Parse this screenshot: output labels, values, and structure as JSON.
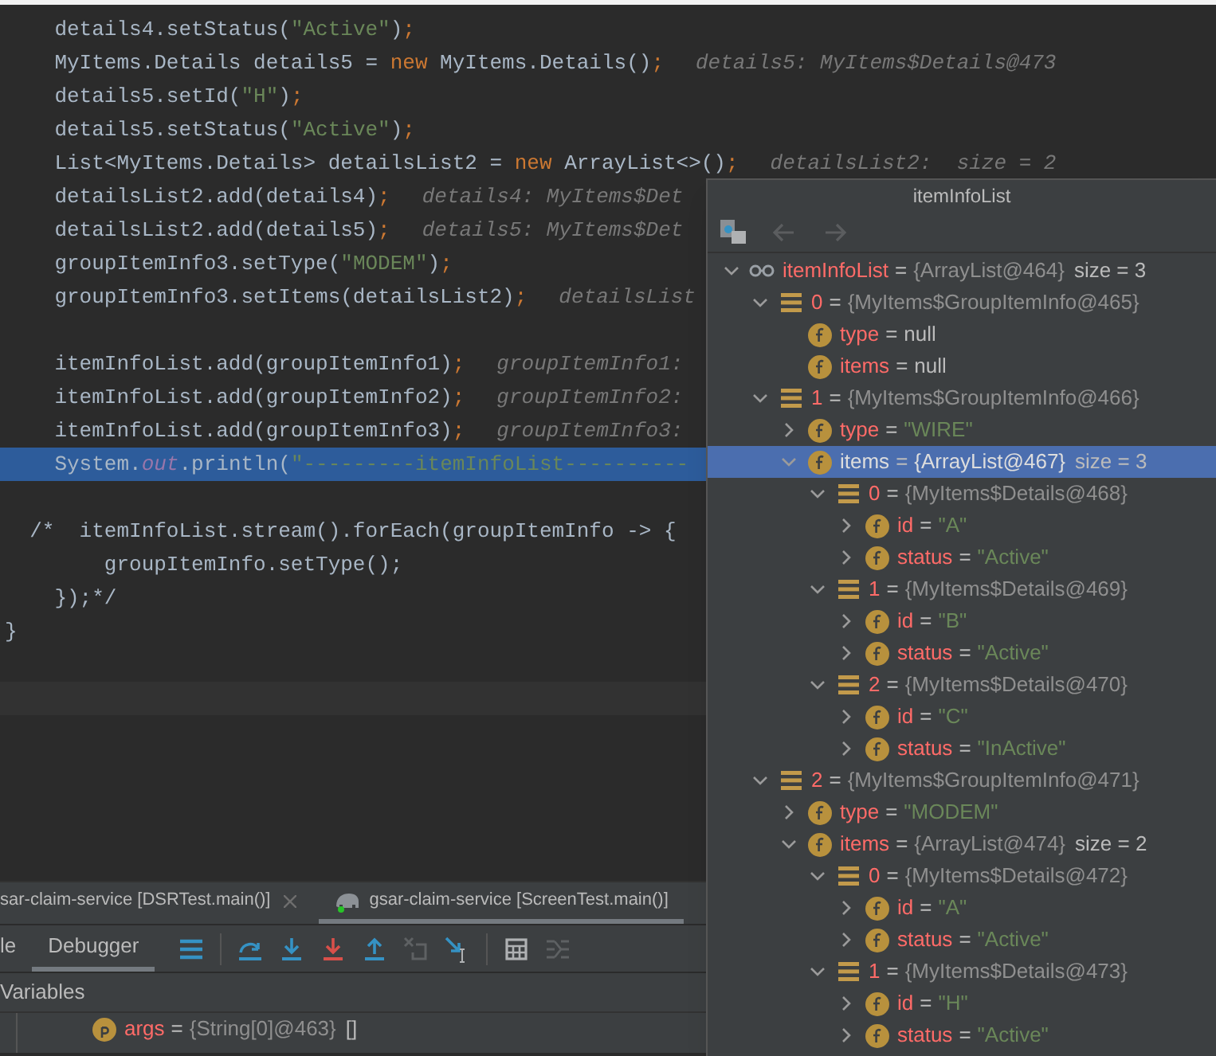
{
  "editor": {
    "lines": [
      {
        "kind": "code",
        "segments": [
          {
            "kind": "plain",
            "text": "    details4.setStatus("
          },
          {
            "kind": "string",
            "text": "\"Active\""
          },
          {
            "kind": "plain",
            "text": ")"
          },
          {
            "kind": "punct",
            "text": ";"
          }
        ]
      },
      {
        "kind": "code",
        "segments": [
          {
            "kind": "plain",
            "text": "    MyItems.Details details5 = "
          },
          {
            "kind": "keyword",
            "text": "new"
          },
          {
            "kind": "plain",
            "text": " MyItems.Details()"
          },
          {
            "kind": "punct",
            "text": ";"
          },
          {
            "kind": "hint",
            "text": "details5: MyItems$Details@473"
          }
        ]
      },
      {
        "kind": "code",
        "segments": [
          {
            "kind": "plain",
            "text": "    details5.setId("
          },
          {
            "kind": "string",
            "text": "\"H\""
          },
          {
            "kind": "plain",
            "text": ")"
          },
          {
            "kind": "punct",
            "text": ";"
          }
        ]
      },
      {
        "kind": "code",
        "segments": [
          {
            "kind": "plain",
            "text": "    details5.setStatus("
          },
          {
            "kind": "string",
            "text": "\"Active\""
          },
          {
            "kind": "plain",
            "text": ")"
          },
          {
            "kind": "punct",
            "text": ";"
          }
        ]
      },
      {
        "kind": "code",
        "segments": [
          {
            "kind": "plain",
            "text": "    List<MyItems.Details> detailsList2 = "
          },
          {
            "kind": "keyword",
            "text": "new"
          },
          {
            "kind": "plain",
            "text": " ArrayList<>()"
          },
          {
            "kind": "punct",
            "text": ";"
          },
          {
            "kind": "hint",
            "text": "detailsList2:  size = 2"
          }
        ]
      },
      {
        "kind": "code",
        "segments": [
          {
            "kind": "plain",
            "text": "    detailsList2.add(details4)"
          },
          {
            "kind": "punct",
            "text": ";"
          },
          {
            "kind": "hint",
            "text": "details4: MyItems$Det"
          }
        ]
      },
      {
        "kind": "code",
        "segments": [
          {
            "kind": "plain",
            "text": "    detailsList2.add(details5)"
          },
          {
            "kind": "punct",
            "text": ";"
          },
          {
            "kind": "hint",
            "text": "details5: MyItems$Det"
          }
        ]
      },
      {
        "kind": "code",
        "segments": [
          {
            "kind": "plain",
            "text": "    groupItemInfo3.setType("
          },
          {
            "kind": "string",
            "text": "\"MODEM\""
          },
          {
            "kind": "plain",
            "text": ")"
          },
          {
            "kind": "punct",
            "text": ";"
          }
        ]
      },
      {
        "kind": "code",
        "segments": [
          {
            "kind": "plain",
            "text": "    groupItemInfo3.setItems(detailsList2)"
          },
          {
            "kind": "punct",
            "text": ";"
          },
          {
            "kind": "hint",
            "text": "detailsList"
          }
        ]
      },
      {
        "kind": "blank"
      },
      {
        "kind": "code",
        "segments": [
          {
            "kind": "plain",
            "text": "    itemInfoList.add(groupItemInfo1)"
          },
          {
            "kind": "punct",
            "text": ";"
          },
          {
            "kind": "hint",
            "text": "groupItemInfo1:"
          }
        ]
      },
      {
        "kind": "code",
        "segments": [
          {
            "kind": "plain",
            "text": "    itemInfoList.add(groupItemInfo2)"
          },
          {
            "kind": "punct",
            "text": ";"
          },
          {
            "kind": "hint",
            "text": "groupItemInfo2:"
          }
        ]
      },
      {
        "kind": "code",
        "segments": [
          {
            "kind": "plain",
            "text": "    itemInfoList.add(groupItemInfo3)"
          },
          {
            "kind": "punct",
            "text": ";"
          },
          {
            "kind": "hint",
            "text": "groupItemInfo3:"
          }
        ]
      },
      {
        "kind": "execution",
        "segments": [
          {
            "kind": "plain",
            "text": "    System."
          },
          {
            "kind": "field",
            "text": "out"
          },
          {
            "kind": "plain",
            "text": ".println("
          },
          {
            "kind": "string",
            "text": "\"---------itemInfoList----------"
          }
        ]
      },
      {
        "kind": "blank"
      },
      {
        "kind": "code",
        "segments": [
          {
            "kind": "plain",
            "text": "  /*  itemInfoList.stream().forEach(groupItemInfo -> {"
          }
        ]
      },
      {
        "kind": "code",
        "segments": [
          {
            "kind": "plain",
            "text": "        groupItemInfo.setType();"
          }
        ]
      },
      {
        "kind": "code",
        "segments": [
          {
            "kind": "plain",
            "text": "    });*/"
          }
        ]
      },
      {
        "kind": "code",
        "segments": [
          {
            "kind": "plain",
            "text": "}"
          }
        ]
      },
      {
        "kind": "blank"
      },
      {
        "kind": "caret"
      }
    ]
  },
  "inspect_window": {
    "title": "itemInfoList",
    "nav": [
      {
        "kind": "back",
        "disabled": true
      },
      {
        "kind": "forward",
        "disabled": true
      }
    ],
    "tree": [
      {
        "kind": "watch",
        "name": "itemInfoList",
        "sep": "=",
        "value": {
          "kind": "ref",
          "text": "{ArrayList@464}"
        },
        "extra": "size = 3",
        "expanded": true,
        "selected": false,
        "children": [
          {
            "kind": "object",
            "name": "0",
            "sep": "=",
            "value": {
              "kind": "ref",
              "text": "{MyItems$GroupItemInfo@465}"
            },
            "expanded": true,
            "selected": false,
            "children": [
              {
                "kind": "field",
                "name": "type",
                "sep": "=",
                "value": {
                  "kind": "literal",
                  "text": "null"
                },
                "selected": false
              },
              {
                "kind": "field",
                "name": "items",
                "sep": "=",
                "value": {
                  "kind": "literal",
                  "text": "null"
                },
                "selected": false
              }
            ]
          },
          {
            "kind": "object",
            "name": "1",
            "sep": "=",
            "value": {
              "kind": "ref",
              "text": "{MyItems$GroupItemInfo@466}"
            },
            "expanded": true,
            "selected": false,
            "children": [
              {
                "kind": "field",
                "name": "type",
                "sep": "=",
                "value": {
                  "kind": "string",
                  "text": "\"WIRE\""
                },
                "expanded": false,
                "selected": false
              },
              {
                "kind": "field",
                "name": "items",
                "sep": "=",
                "value": {
                  "kind": "ref",
                  "text": "{ArrayList@467}"
                },
                "extra": "size = 3",
                "expanded": true,
                "selected": true,
                "children": [
                  {
                    "kind": "object",
                    "name": "0",
                    "sep": "=",
                    "value": {
                      "kind": "ref",
                      "text": "{MyItems$Details@468}"
                    },
                    "expanded": true,
                    "selected": false,
                    "children": [
                      {
                        "kind": "field",
                        "name": "id",
                        "sep": "=",
                        "value": {
                          "kind": "string",
                          "text": "\"A\""
                        },
                        "expanded": false,
                        "selected": false
                      },
                      {
                        "kind": "field",
                        "name": "status",
                        "sep": "=",
                        "value": {
                          "kind": "string",
                          "text": "\"Active\""
                        },
                        "expanded": false,
                        "selected": false
                      }
                    ]
                  },
                  {
                    "kind": "object",
                    "name": "1",
                    "sep": "=",
                    "value": {
                      "kind": "ref",
                      "text": "{MyItems$Details@469}"
                    },
                    "expanded": true,
                    "selected": false,
                    "children": [
                      {
                        "kind": "field",
                        "name": "id",
                        "sep": "=",
                        "value": {
                          "kind": "string",
                          "text": "\"B\""
                        },
                        "expanded": false,
                        "selected": false
                      },
                      {
                        "kind": "field",
                        "name": "status",
                        "sep": "=",
                        "value": {
                          "kind": "string",
                          "text": "\"Active\""
                        },
                        "expanded": false,
                        "selected": false
                      }
                    ]
                  },
                  {
                    "kind": "object",
                    "name": "2",
                    "sep": "=",
                    "value": {
                      "kind": "ref",
                      "text": "{MyItems$Details@470}"
                    },
                    "expanded": true,
                    "selected": false,
                    "children": [
                      {
                        "kind": "field",
                        "name": "id",
                        "sep": "=",
                        "value": {
                          "kind": "string",
                          "text": "\"C\""
                        },
                        "expanded": false,
                        "selected": false
                      },
                      {
                        "kind": "field",
                        "name": "status",
                        "sep": "=",
                        "value": {
                          "kind": "string",
                          "text": "\"InActive\""
                        },
                        "expanded": false,
                        "selected": false
                      }
                    ]
                  }
                ]
              }
            ]
          },
          {
            "kind": "object",
            "name": "2",
            "sep": "=",
            "value": {
              "kind": "ref",
              "text": "{MyItems$GroupItemInfo@471}"
            },
            "expanded": true,
            "selected": false,
            "children": [
              {
                "kind": "field",
                "name": "type",
                "sep": "=",
                "value": {
                  "kind": "string",
                  "text": "\"MODEM\""
                },
                "expanded": false,
                "selected": false
              },
              {
                "kind": "field",
                "name": "items",
                "sep": "=",
                "value": {
                  "kind": "ref",
                  "text": "{ArrayList@474}"
                },
                "extra": "size = 2",
                "expanded": true,
                "selected": false,
                "children": [
                  {
                    "kind": "object",
                    "name": "0",
                    "sep": "=",
                    "value": {
                      "kind": "ref",
                      "text": "{MyItems$Details@472}"
                    },
                    "expanded": true,
                    "selected": false,
                    "children": [
                      {
                        "kind": "field",
                        "name": "id",
                        "sep": "=",
                        "value": {
                          "kind": "string",
                          "text": "\"A\""
                        },
                        "expanded": false,
                        "selected": false
                      },
                      {
                        "kind": "field",
                        "name": "status",
                        "sep": "=",
                        "value": {
                          "kind": "string",
                          "text": "\"Active\""
                        },
                        "expanded": false,
                        "selected": false
                      }
                    ]
                  },
                  {
                    "kind": "object",
                    "name": "1",
                    "sep": "=",
                    "value": {
                      "kind": "ref",
                      "text": "{MyItems$Details@473}"
                    },
                    "expanded": true,
                    "selected": false,
                    "children": [
                      {
                        "kind": "field",
                        "name": "id",
                        "sep": "=",
                        "value": {
                          "kind": "string",
                          "text": "\"H\""
                        },
                        "expanded": false,
                        "selected": false
                      },
                      {
                        "kind": "field",
                        "name": "status",
                        "sep": "=",
                        "value": {
                          "kind": "string",
                          "text": "\"Active\""
                        },
                        "expanded": false,
                        "selected": false
                      }
                    ]
                  }
                ]
              }
            ]
          }
        ]
      }
    ]
  },
  "run_tabs": [
    {
      "kind": "closable",
      "label": "sar-claim-service [DSRTest.main()]",
      "selected": false
    },
    {
      "kind": "process",
      "label": "gsar-claim-service [ScreenTest.main()]",
      "selected": true
    }
  ],
  "debug_tabs": [
    {
      "label": "le",
      "selected": false
    },
    {
      "label": "Debugger",
      "selected": true
    }
  ],
  "debug_toolbar": [
    {
      "kind": "menu",
      "disabled": false
    },
    {
      "kind": "step-over",
      "disabled": false
    },
    {
      "kind": "step-into",
      "disabled": false
    },
    {
      "kind": "force-step-into",
      "disabled": false
    },
    {
      "kind": "step-out",
      "disabled": false
    },
    {
      "kind": "drop-frame",
      "disabled": true
    },
    {
      "kind": "run-to-cursor",
      "disabled": false
    },
    {
      "kind": "evaluate",
      "disabled": false
    },
    {
      "kind": "trace",
      "disabled": true
    }
  ],
  "variables": {
    "title": "Variables",
    "items": [
      {
        "kind": "param",
        "name": "args",
        "sep": "=",
        "value": {
          "kind": "ref",
          "text": "{String[0]@463}"
        },
        "extra": "[]",
        "selected": false
      }
    ]
  }
}
